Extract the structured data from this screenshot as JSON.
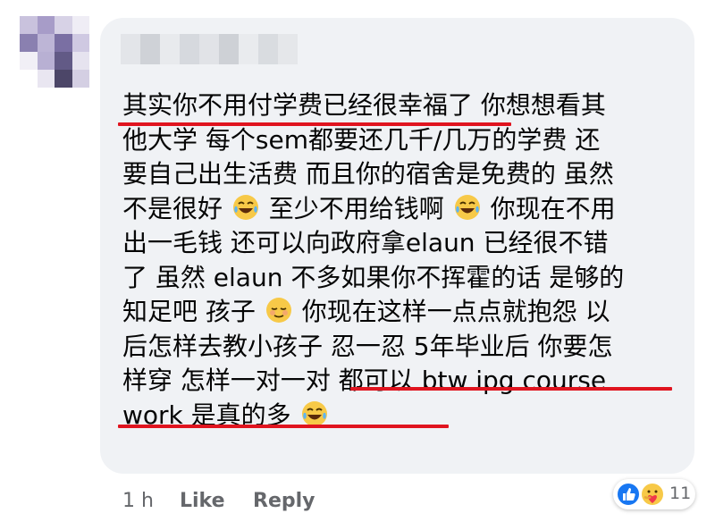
{
  "comment": {
    "author_name": "",
    "lines": [
      "其实你不用付学费已经很幸福了 你想想看其",
      "他大学 每个sem都要还几千/几万的学费 还",
      "要自己出生活费 而且你的宿舍是免费的 虽然",
      [
        "不是很好 ",
        " 至少不用给钱啊 ",
        " 你现在不用"
      ],
      "出一毛钱 还可以向政府拿elaun 已经很不错",
      "了 虽然 elaun 不多如果你不挥霍的话 是够的",
      [
        "知足吧 孩子 ",
        " 你现在这样一点点就抱怨 以"
      ],
      "后怎样去教小孩子 忍一忍 5年毕业后 你要怎",
      "样穿 怎样一对一对 都可以 btw ipg course",
      [
        "work 是真的多 ",
        ""
      ]
    ],
    "emojis": {
      "line4_a": "laughing-tears-emoji",
      "line4_b": "laughing-tears-emoji",
      "line7": "relieved-face-emoji",
      "line10": "laughing-tears-emoji"
    }
  },
  "actions": {
    "time": "1 h",
    "like_label": "Like",
    "reply_label": "Reply"
  },
  "reactions": {
    "count": "11",
    "types": [
      "like-reaction-icon",
      "care-reaction-icon"
    ]
  },
  "colors": {
    "bubble": "#f0f2f5",
    "text": "#050505",
    "underline": "#e0141f",
    "like_blue": "#1877f2",
    "muted": "#65676b"
  }
}
